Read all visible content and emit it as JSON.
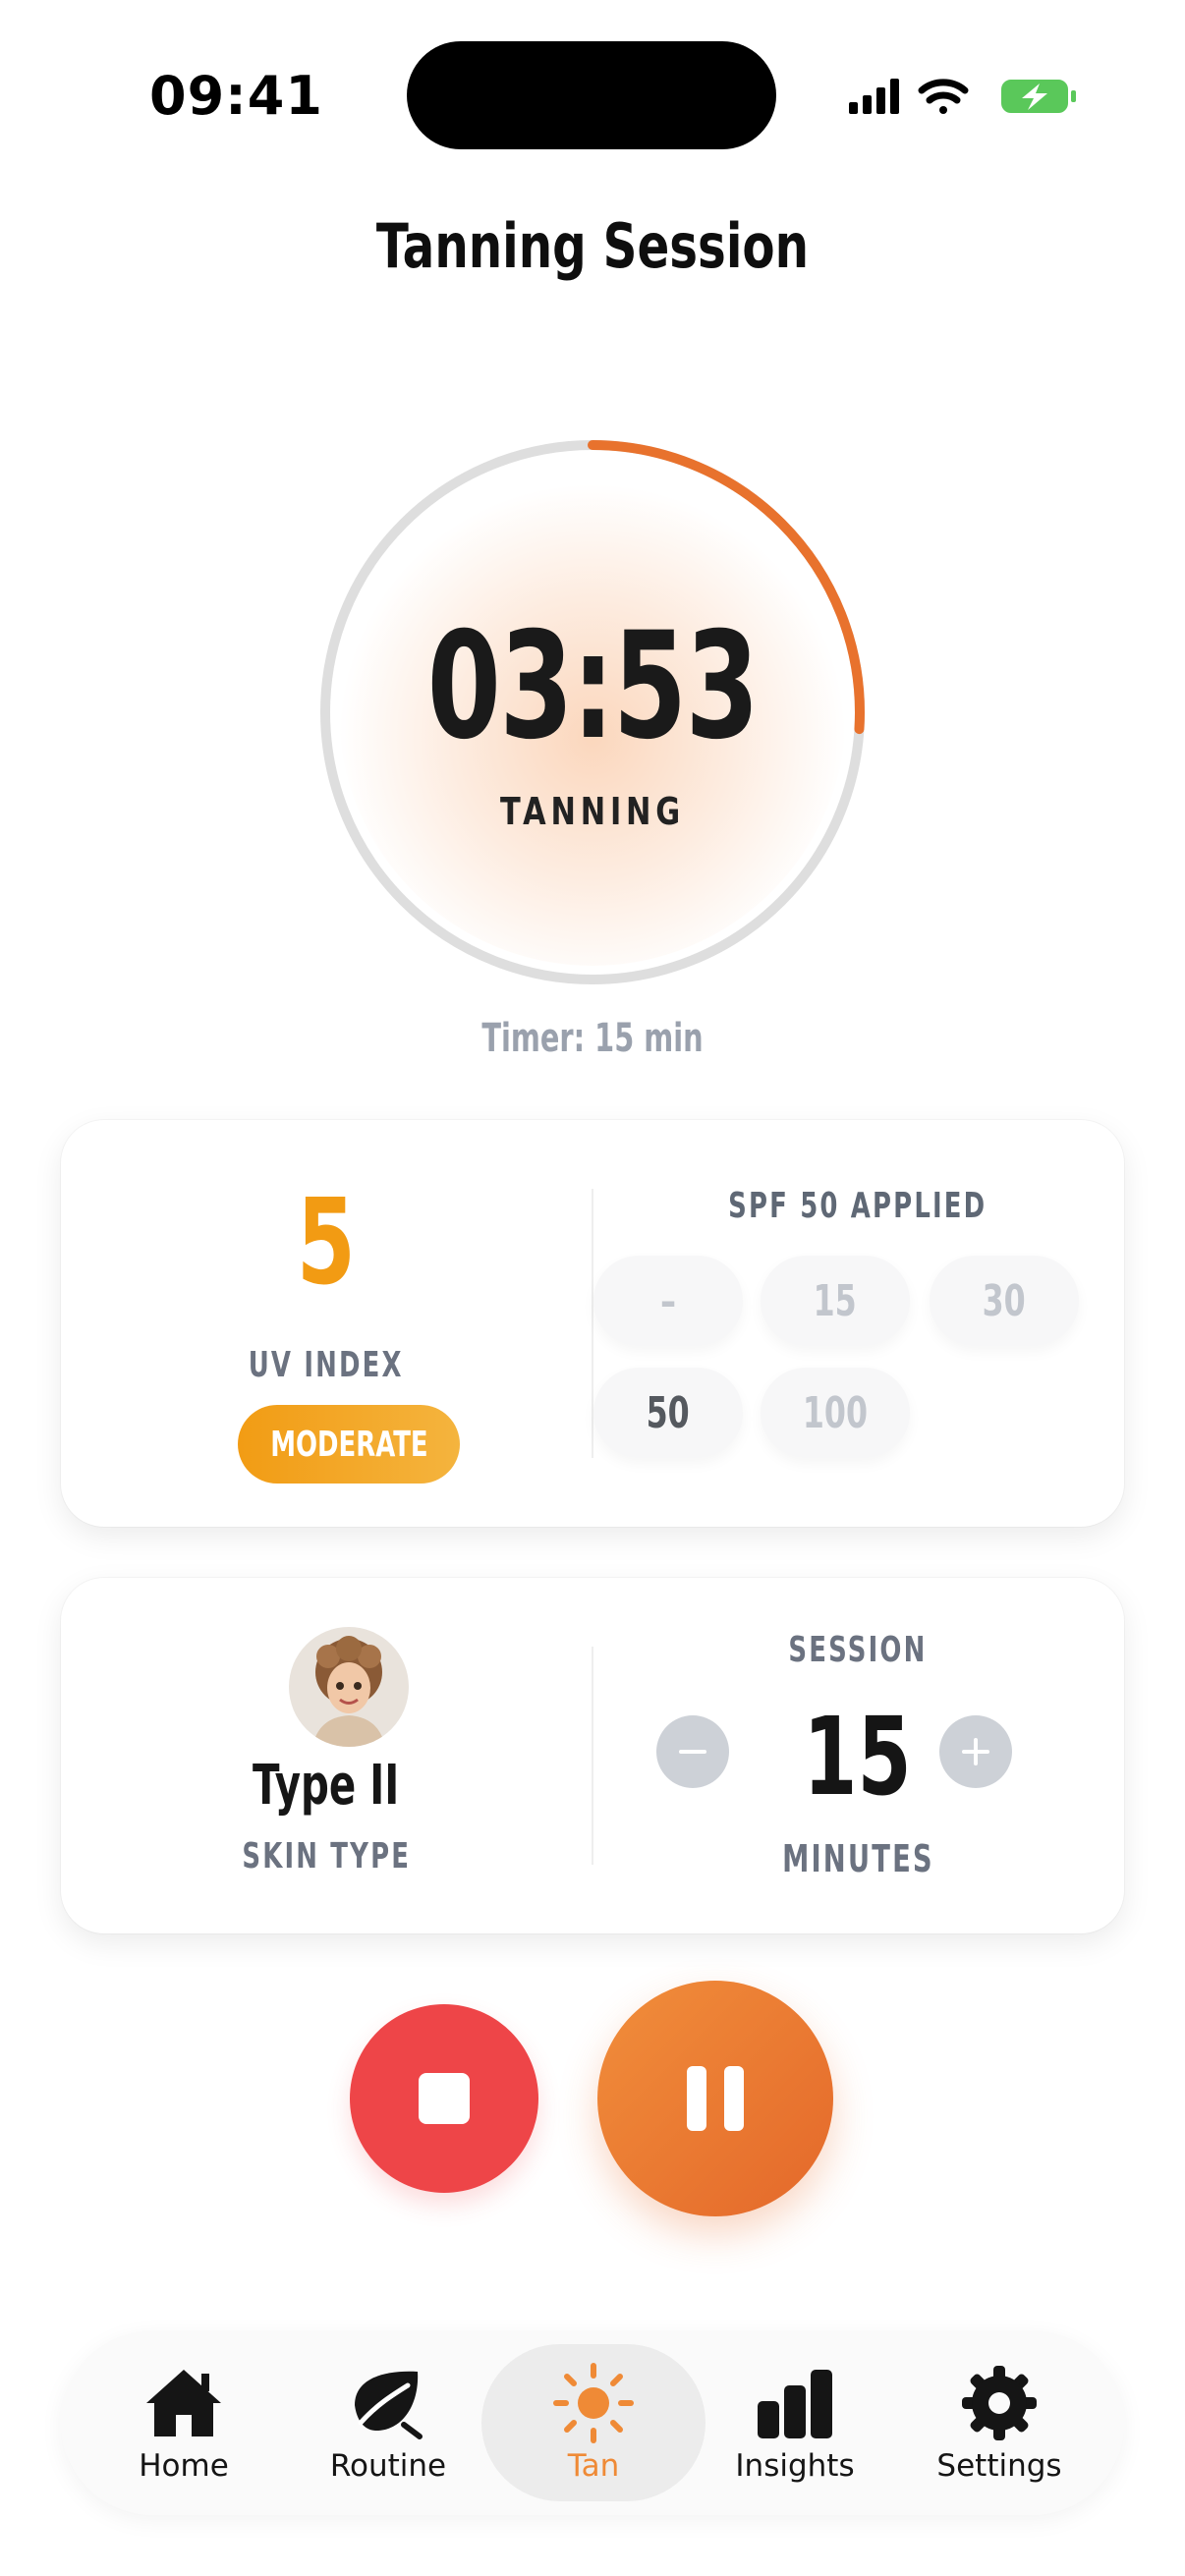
{
  "status_bar": {
    "time": "09:41"
  },
  "header": {
    "title": "Tanning Session"
  },
  "timer": {
    "time_display": "03:53",
    "state_label": "TANNING",
    "caption": "Timer: 15 min",
    "progress": 0.26,
    "accent_color": "#E8722D"
  },
  "uv": {
    "value": "5",
    "label": "UV INDEX",
    "level_badge": "MODERATE"
  },
  "spf": {
    "title": "SPF 50 APPLIED",
    "options": [
      "–",
      "15",
      "30",
      "50",
      "100"
    ],
    "selected": "50"
  },
  "skin": {
    "type": "Type II",
    "label": "SKIN TYPE",
    "avatar_icon": "avatar"
  },
  "session": {
    "label": "SESSION",
    "minutes": "15",
    "unit": "MINUTES"
  },
  "actions": {
    "stop_icon": "stop-icon",
    "pause_icon": "pause-icon"
  },
  "tabbar": {
    "tabs": [
      {
        "label": "Home",
        "icon": "home-icon"
      },
      {
        "label": "Routine",
        "icon": "leaf-icon"
      },
      {
        "label": "Tan",
        "icon": "sun-icon",
        "active": true
      },
      {
        "label": "Insights",
        "icon": "bar-chart-icon"
      },
      {
        "label": "Settings",
        "icon": "gear-icon"
      }
    ]
  }
}
